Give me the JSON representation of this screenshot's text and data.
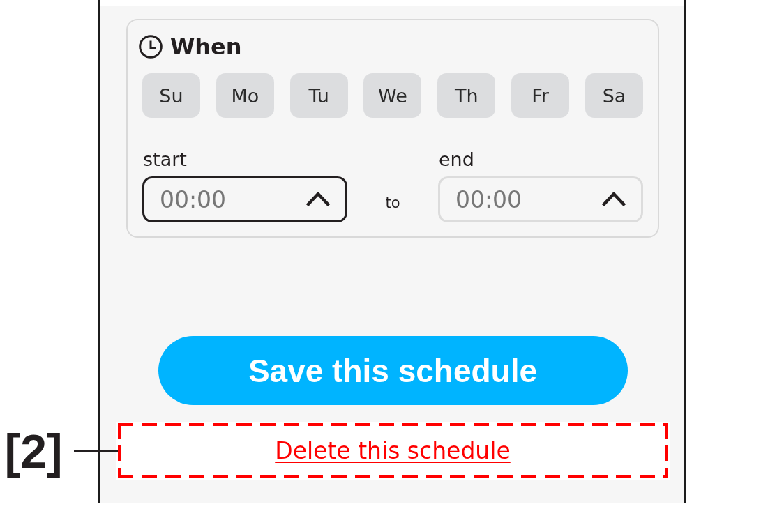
{
  "card": {
    "title": "When",
    "days": [
      {
        "label": "Su",
        "selected": false
      },
      {
        "label": "Mo",
        "selected": false
      },
      {
        "label": "Tu",
        "selected": false
      },
      {
        "label": "We",
        "selected": false
      },
      {
        "label": "Th",
        "selected": false
      },
      {
        "label": "Fr",
        "selected": false
      },
      {
        "label": "Sa",
        "selected": false
      }
    ],
    "start": {
      "label": "start",
      "placeholder": "00:00",
      "focused": true
    },
    "separator": "to",
    "end": {
      "label": "end",
      "placeholder": "00:00",
      "focused": false
    }
  },
  "save_button": {
    "label": "Save this schedule"
  },
  "delete_link": {
    "label": "Delete this schedule"
  },
  "callout": {
    "label": "[2]"
  }
}
